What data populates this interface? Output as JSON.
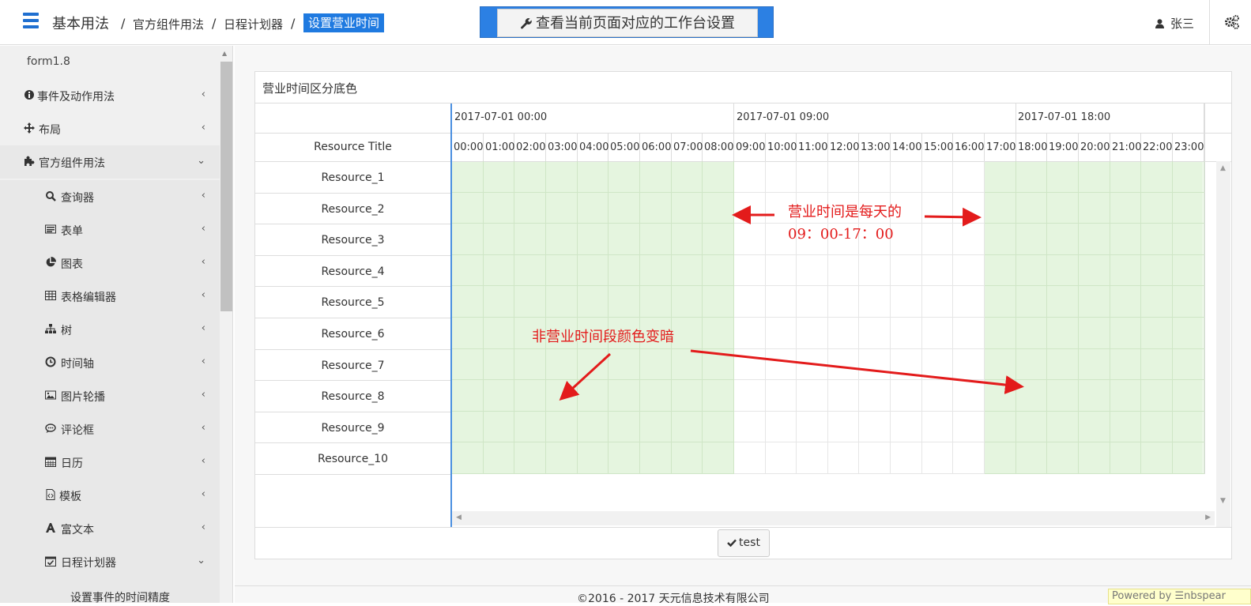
{
  "header": {
    "home": "基本用法",
    "breadcrumbs": [
      "官方组件用法",
      "日程计划器"
    ],
    "active": "设置营业时间",
    "workspace_button": "查看当前页面对应的工作台设置",
    "user": "张三",
    "icons": {
      "menu": "hamburger-icon",
      "wrench": "wrench-icon",
      "user": "user-icon",
      "settings": "cogs-icon"
    }
  },
  "sidebar": {
    "version": "form1.8",
    "items": [
      {
        "label": "事件及动作用法",
        "icon": "info-circle-icon",
        "chevron": "‹"
      },
      {
        "label": "布局",
        "icon": "arrows-icon",
        "chevron": "‹"
      },
      {
        "label": "官方组件用法",
        "icon": "puzzle-icon",
        "chevron": "⌄"
      },
      {
        "label": "查询器",
        "icon": "search-icon",
        "chevron": "‹"
      },
      {
        "label": "表单",
        "icon": "list-icon",
        "chevron": "‹"
      },
      {
        "label": "图表",
        "icon": "pie-chart-icon",
        "chevron": "‹"
      },
      {
        "label": "表格编辑器",
        "icon": "table-icon",
        "chevron": "‹"
      },
      {
        "label": "树",
        "icon": "sitemap-icon",
        "chevron": "‹"
      },
      {
        "label": "时间轴",
        "icon": "clock-icon",
        "chevron": "‹"
      },
      {
        "label": "图片轮播",
        "icon": "image-icon",
        "chevron": "‹"
      },
      {
        "label": "评论框",
        "icon": "comment-icon",
        "chevron": "‹"
      },
      {
        "label": "日历",
        "icon": "calendar-icon",
        "chevron": "‹"
      },
      {
        "label": "模板",
        "icon": "file-code-icon",
        "chevron": "‹"
      },
      {
        "label": "富文本",
        "icon": "font-icon",
        "chevron": "‹"
      },
      {
        "label": "日程计划器",
        "icon": "calendar-check-icon",
        "chevron": "⌄"
      },
      {
        "label": "设置事件的时间精度",
        "icon": "",
        "chevron": ""
      }
    ]
  },
  "panel": {
    "title": "营业时间区分底色",
    "resource_header": "Resource Title",
    "days": [
      "2017-07-01 00:00",
      "2017-07-01 09:00",
      "2017-07-01 18:00"
    ],
    "hours": [
      "00:00",
      "01:00",
      "02:00",
      "03:00",
      "04:00",
      "05:00",
      "06:00",
      "07:00",
      "08:00",
      "09:00",
      "10:00",
      "11:00",
      "12:00",
      "13:00",
      "14:00",
      "15:00",
      "16:00",
      "17:00",
      "18:00",
      "19:00",
      "20:00",
      "21:00",
      "22:00",
      "23:00"
    ],
    "resources": [
      "Resource_1",
      "Resource_2",
      "Resource_3",
      "Resource_4",
      "Resource_5",
      "Resource_6",
      "Resource_7",
      "Resource_8",
      "Resource_9",
      "Resource_10"
    ],
    "business_hours": {
      "start": "09:00",
      "end": "17:00"
    },
    "colors": {
      "off_hours": "#e5f5df",
      "accent": "#1f7ae0",
      "annotation": "#e31b1b"
    },
    "test_button": "test"
  },
  "annotations": {
    "business_line1": "营业时间是每天的",
    "business_line2": "09：00-17：00",
    "off_hours": "非营业时间段颜色变暗"
  },
  "footer": {
    "copyright": "©2016 - 2017 天元信息技术有限公司",
    "powered": "Powered by ☰nbspear"
  }
}
